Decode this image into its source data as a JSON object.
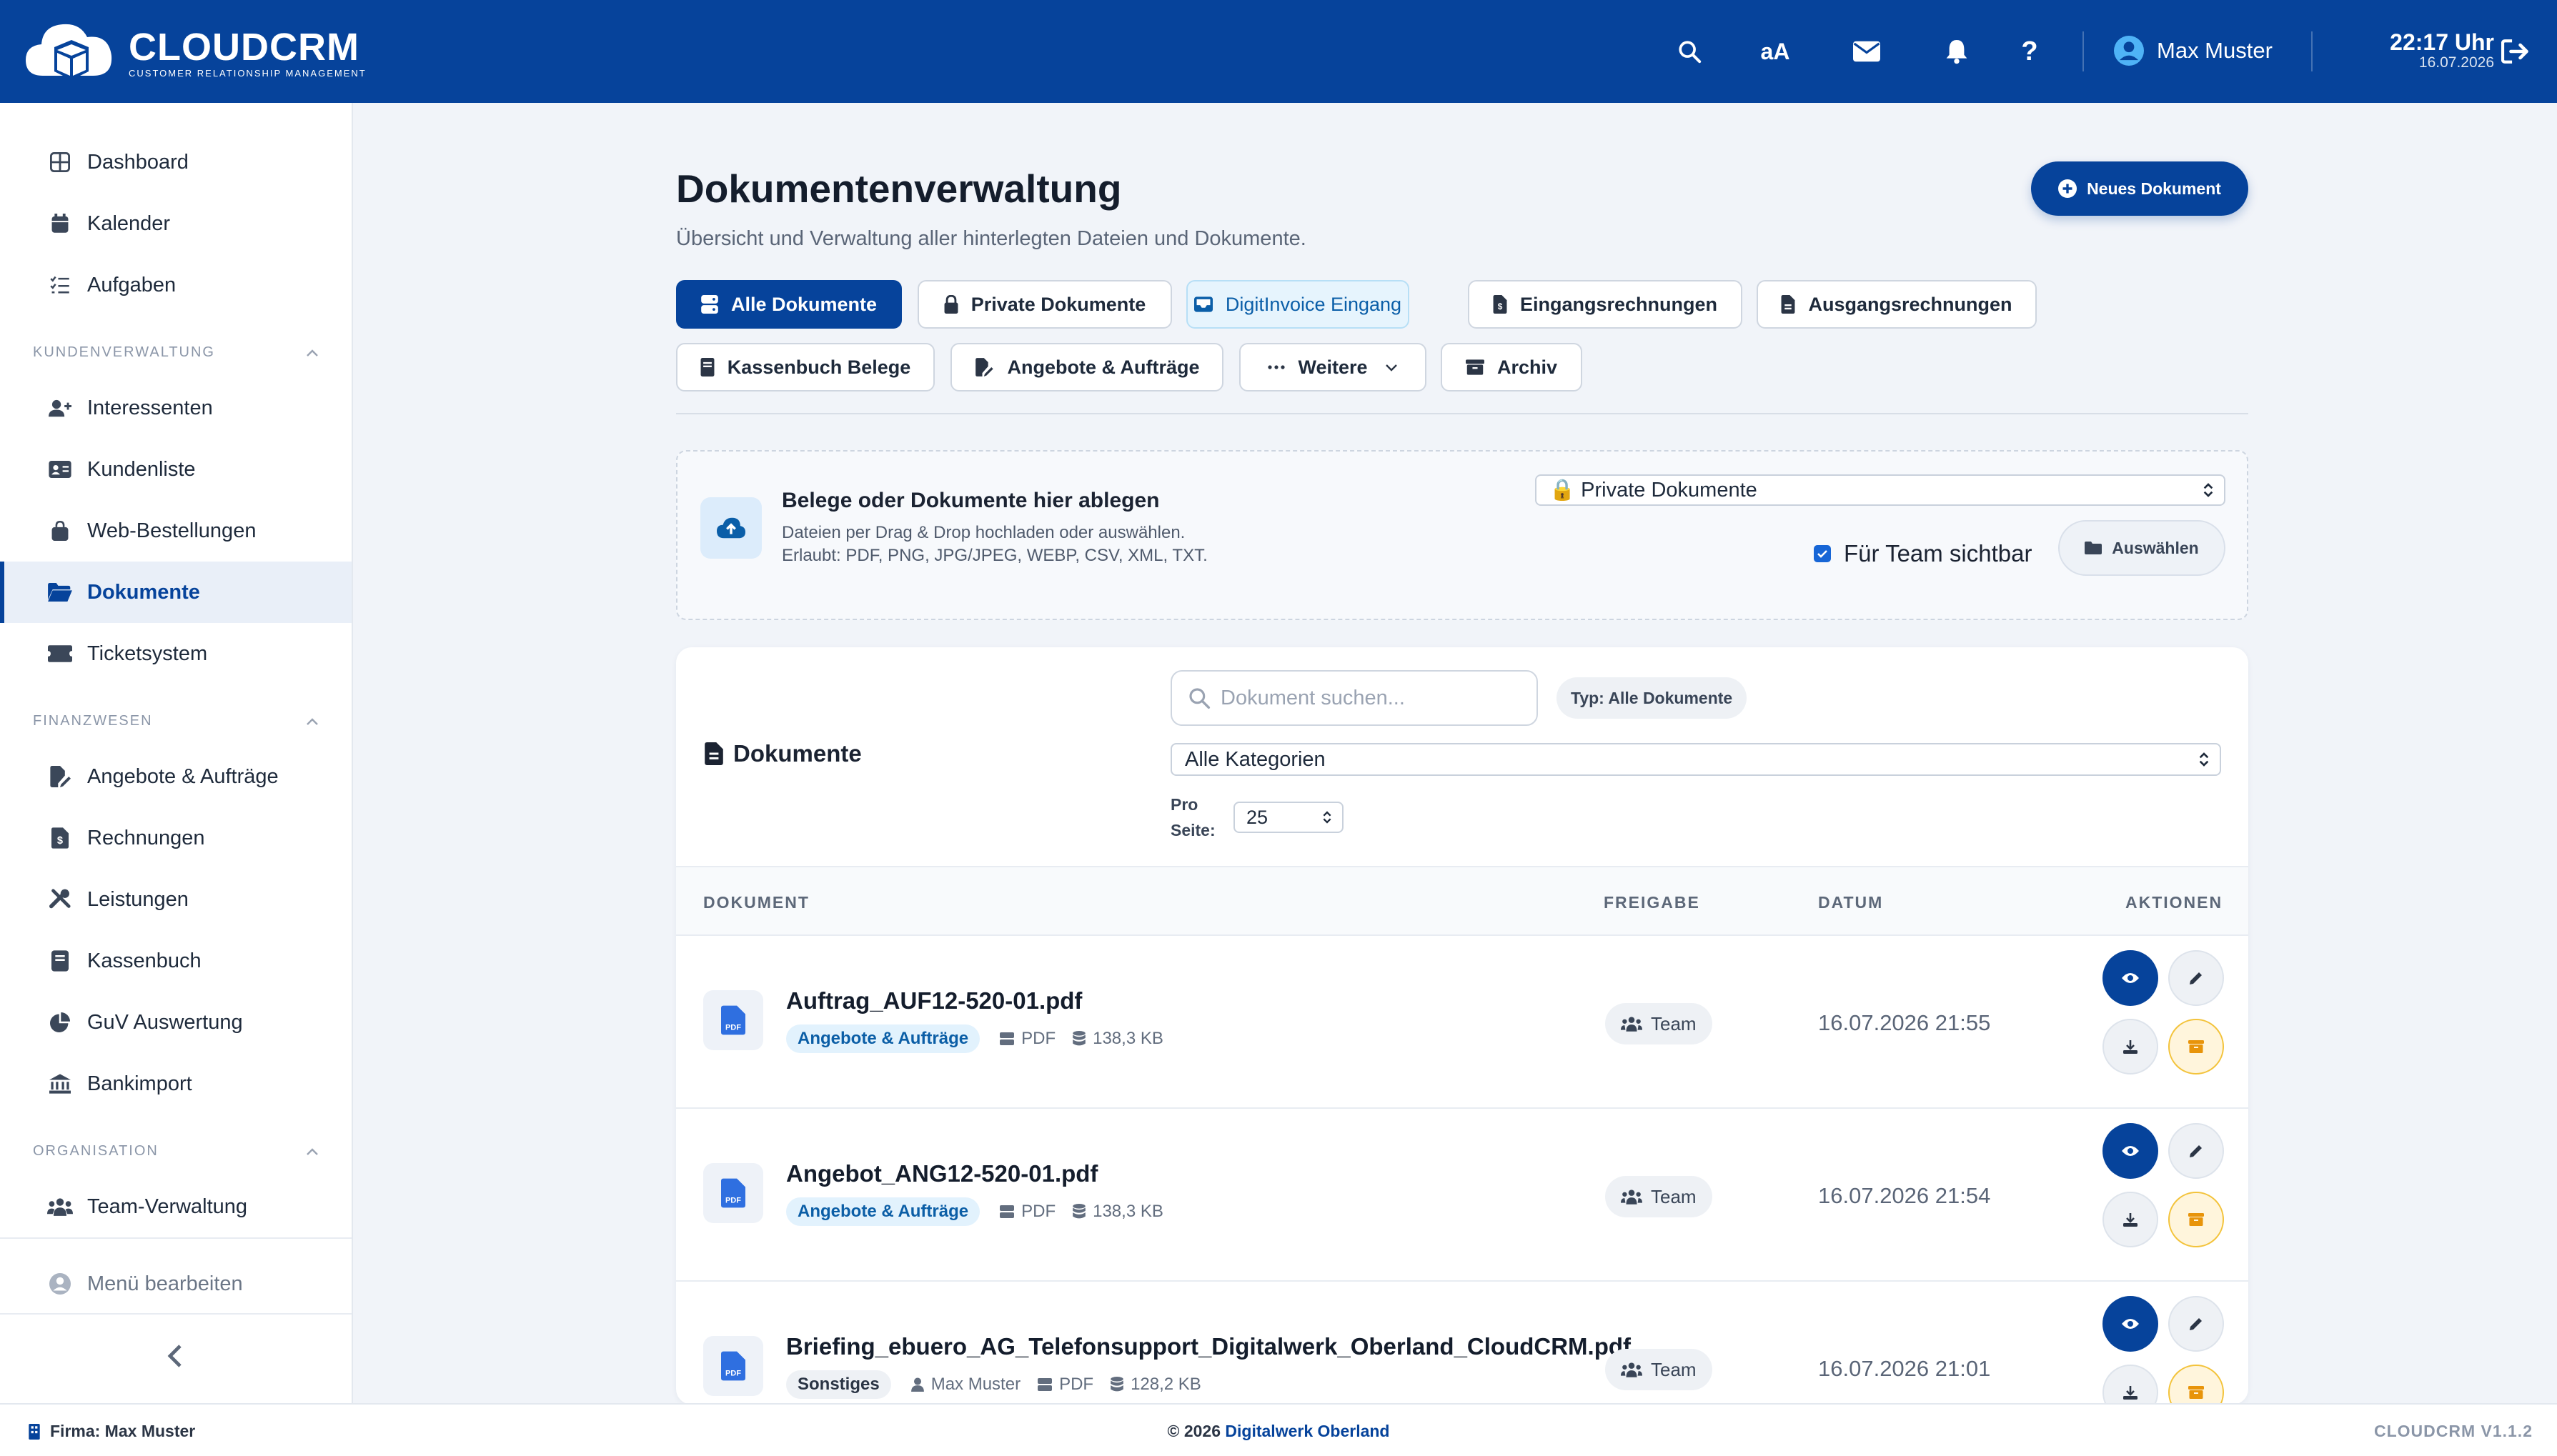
{
  "header": {
    "logo_title": "CLOUDCRM",
    "logo_subtitle": "CUSTOMER RELATIONSHIP MANAGEMENT",
    "font_size_label": "aA",
    "user_name": "Max Muster",
    "time": "22:17 Uhr",
    "date": "16.07.2026",
    "icons": [
      "search-icon",
      "font-size-icon",
      "mail-icon",
      "bell-icon",
      "help-icon",
      "user-icon",
      "logout-icon"
    ]
  },
  "sidebar": {
    "items_top": [
      {
        "label": "Dashboard",
        "icon": "dashboard-icon"
      },
      {
        "label": "Kalender",
        "icon": "calendar-icon"
      },
      {
        "label": "Aufgaben",
        "icon": "tasks-icon"
      }
    ],
    "section_customers": "KUNDENVERWALTUNG",
    "items_customers": [
      {
        "label": "Interessenten",
        "icon": "user-plus-icon"
      },
      {
        "label": "Kundenliste",
        "icon": "contact-card-icon"
      },
      {
        "label": "Web-Bestellungen",
        "icon": "shopping-bag-icon"
      },
      {
        "label": "Dokumente",
        "icon": "folder-open-icon",
        "active": true
      },
      {
        "label": "Ticketsystem",
        "icon": "ticket-icon"
      }
    ],
    "section_finance": "FINANZWESEN",
    "items_finance": [
      {
        "label": "Angebote & Aufträge",
        "icon": "file-signature-icon"
      },
      {
        "label": "Rechnungen",
        "icon": "invoice-icon"
      },
      {
        "label": "Leistungen",
        "icon": "tools-icon"
      },
      {
        "label": "Kassenbuch",
        "icon": "book-icon"
      },
      {
        "label": "GuV Auswertung",
        "icon": "pie-chart-icon"
      },
      {
        "label": "Bankimport",
        "icon": "bank-icon"
      }
    ],
    "section_org": "ORGANISATION",
    "items_org": [
      {
        "label": "Team-Verwaltung",
        "icon": "users-icon"
      }
    ],
    "edit_menu_label": "Menü bearbeiten"
  },
  "main": {
    "title": "Dokumentenverwaltung",
    "subtitle": "Übersicht und Verwaltung aller hinterlegten Dateien und Dokumente.",
    "new_button": "Neues Dokument",
    "tabs": [
      {
        "label": "Alle Dokumente",
        "icon": "server-icon",
        "state": "active"
      },
      {
        "label": "Private Dokumente",
        "icon": "lock-icon"
      },
      {
        "label": "DigitInvoice Eingang",
        "icon": "inbox-icon",
        "state": "info"
      },
      {
        "label": "Eingangsrechnungen",
        "icon": "invoice-in-icon"
      },
      {
        "label": "Ausgangsrechnungen",
        "icon": "invoice-out-icon"
      },
      {
        "label": "Kassenbuch Belege",
        "icon": "book-icon"
      },
      {
        "label": "Angebote & Aufträge",
        "icon": "file-signature-icon"
      },
      {
        "label": "Weitere",
        "icon": "dots-icon"
      },
      {
        "label": "Archiv",
        "icon": "archive-icon"
      }
    ]
  },
  "upload": {
    "title": "Belege oder Dokumente hier ablegen",
    "desc1": "Dateien per Drag & Drop hochladen oder auswählen.",
    "desc2": "Erlaubt: PDF, PNG, JPG/JPEG, WEBP, CSV, XML, TXT.",
    "target_select": "🔒 Private Dokumente",
    "team_visible_label": "Für Team sichtbar",
    "team_visible_checked": true,
    "choose_button": "Auswählen"
  },
  "documents": {
    "title": "Dokumente",
    "search_placeholder": "Dokument suchen...",
    "type_badge": "Typ: Alle Dokumente",
    "category_select": "Alle Kategorien",
    "per_page_label_1": "Pro",
    "per_page_label_2": "Seite:",
    "per_page_value": "25",
    "columns": [
      "DOKUMENT",
      "FREIGABE",
      "DATUM",
      "AKTIONEN"
    ],
    "rows": [
      {
        "name": "Auftrag_AUF12-520-01.pdf",
        "category": "Angebote & Aufträge",
        "category_style": "blue",
        "owner": "",
        "type": "PDF",
        "size": "138,3 KB",
        "share": "Team",
        "date": "16.07.2026 21:55"
      },
      {
        "name": "Angebot_ANG12-520-01.pdf",
        "category": "Angebote & Aufträge",
        "category_style": "blue",
        "owner": "",
        "type": "PDF",
        "size": "138,3 KB",
        "share": "Team",
        "date": "16.07.2026 21:54"
      },
      {
        "name": "Briefing_ebuero_AG_Telefonsupport_Digitalwerk_Oberland_CloudCRM.pdf",
        "category": "Sonstiges",
        "category_style": "gray",
        "owner": "Max Muster",
        "type": "PDF",
        "size": "128,2 KB",
        "share": "Team",
        "date": "16.07.2026 21:01"
      }
    ]
  },
  "footer": {
    "company": "Firma: Max Muster",
    "copyright": "© 2026",
    "company_link": "Digitalwerk Oberland",
    "version": "CLOUDCRM V1.1.2"
  },
  "colors": {
    "brand": "#06439b",
    "background": "#f1f4f9",
    "info_tab": "#e6f4fd",
    "archive_accent": "#f3c33b"
  }
}
